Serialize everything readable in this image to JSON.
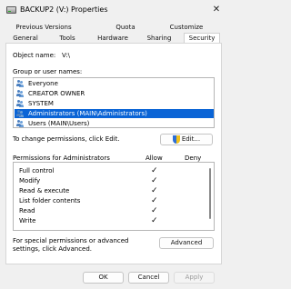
{
  "window": {
    "title": "BACKUP2 (V:) Properties",
    "close_glyph": "✕",
    "icon": "drive-icon"
  },
  "tabs": {
    "row1": [
      "Previous Versions",
      "Quota",
      "Customize"
    ],
    "row2": [
      "General",
      "Tools",
      "Hardware",
      "Sharing",
      "Security"
    ],
    "active": "Security"
  },
  "security": {
    "object_name_label": "Object name:",
    "object_name_value": "V:\\",
    "groups_label": "Group or user names:",
    "users": [
      "Everyone",
      "CREATOR OWNER",
      "SYSTEM",
      "Administrators (MAIN\\Administrators)",
      "Users (MAIN\\Users)"
    ],
    "selected_user_index": 3,
    "change_label": "To change permissions, click Edit.",
    "edit_button": "Edit...",
    "permissions_title": "Permissions for Administrators",
    "allow_header": "Allow",
    "deny_header": "Deny",
    "permissions": [
      {
        "name": "Full control",
        "allow": true,
        "deny": false
      },
      {
        "name": "Modify",
        "allow": true,
        "deny": false
      },
      {
        "name": "Read & execute",
        "allow": true,
        "deny": false
      },
      {
        "name": "List folder contents",
        "allow": true,
        "deny": false
      },
      {
        "name": "Read",
        "allow": true,
        "deny": false
      },
      {
        "name": "Write",
        "allow": true,
        "deny": false
      }
    ],
    "check_glyph": "✓",
    "special_label": "For special permissions or advanced settings, click Advanced.",
    "advanced_button": "Advanced"
  },
  "footer": {
    "ok_button": "OK",
    "cancel_button": "Cancel",
    "apply_button": "Apply"
  },
  "colors": {
    "selection": "#0a64d6",
    "window_bg": "#f0f0f0"
  }
}
